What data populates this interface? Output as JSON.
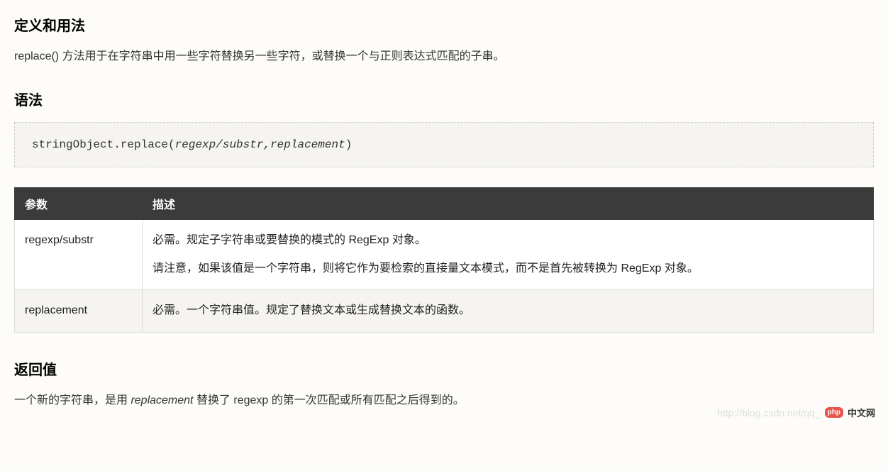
{
  "sections": {
    "definition_heading": "定义和用法",
    "definition_text": "replace() 方法用于在字符串中用一些字符替换另一些字符，或替换一个与正则表达式匹配的子串。",
    "syntax_heading": "语法",
    "syntax_code_prefix": "stringObject.replace(",
    "syntax_code_args": "regexp/substr,replacement",
    "syntax_code_suffix": ")",
    "return_heading": "返回值",
    "return_text_prefix": "一个新的字符串，是用 ",
    "return_text_italic": "replacement",
    "return_text_suffix": " 替换了 regexp 的第一次匹配或所有匹配之后得到的。"
  },
  "table": {
    "headers": {
      "param": "参数",
      "desc": "描述"
    },
    "rows": [
      {
        "param": "regexp/substr",
        "desc_line1": "必需。规定子字符串或要替换的模式的 RegExp 对象。",
        "desc_line2": "请注意，如果该值是一个字符串，则将它作为要检索的直接量文本模式，而不是首先被转换为 RegExp 对象。"
      },
      {
        "param": "replacement",
        "desc_line1": "必需。一个字符串值。规定了替换文本或生成替换文本的函数。",
        "desc_line2": ""
      }
    ]
  },
  "watermark": {
    "blog_url": "http://blog.csdn.net/qq_",
    "logo_badge": "php",
    "logo_text": "中文网"
  }
}
